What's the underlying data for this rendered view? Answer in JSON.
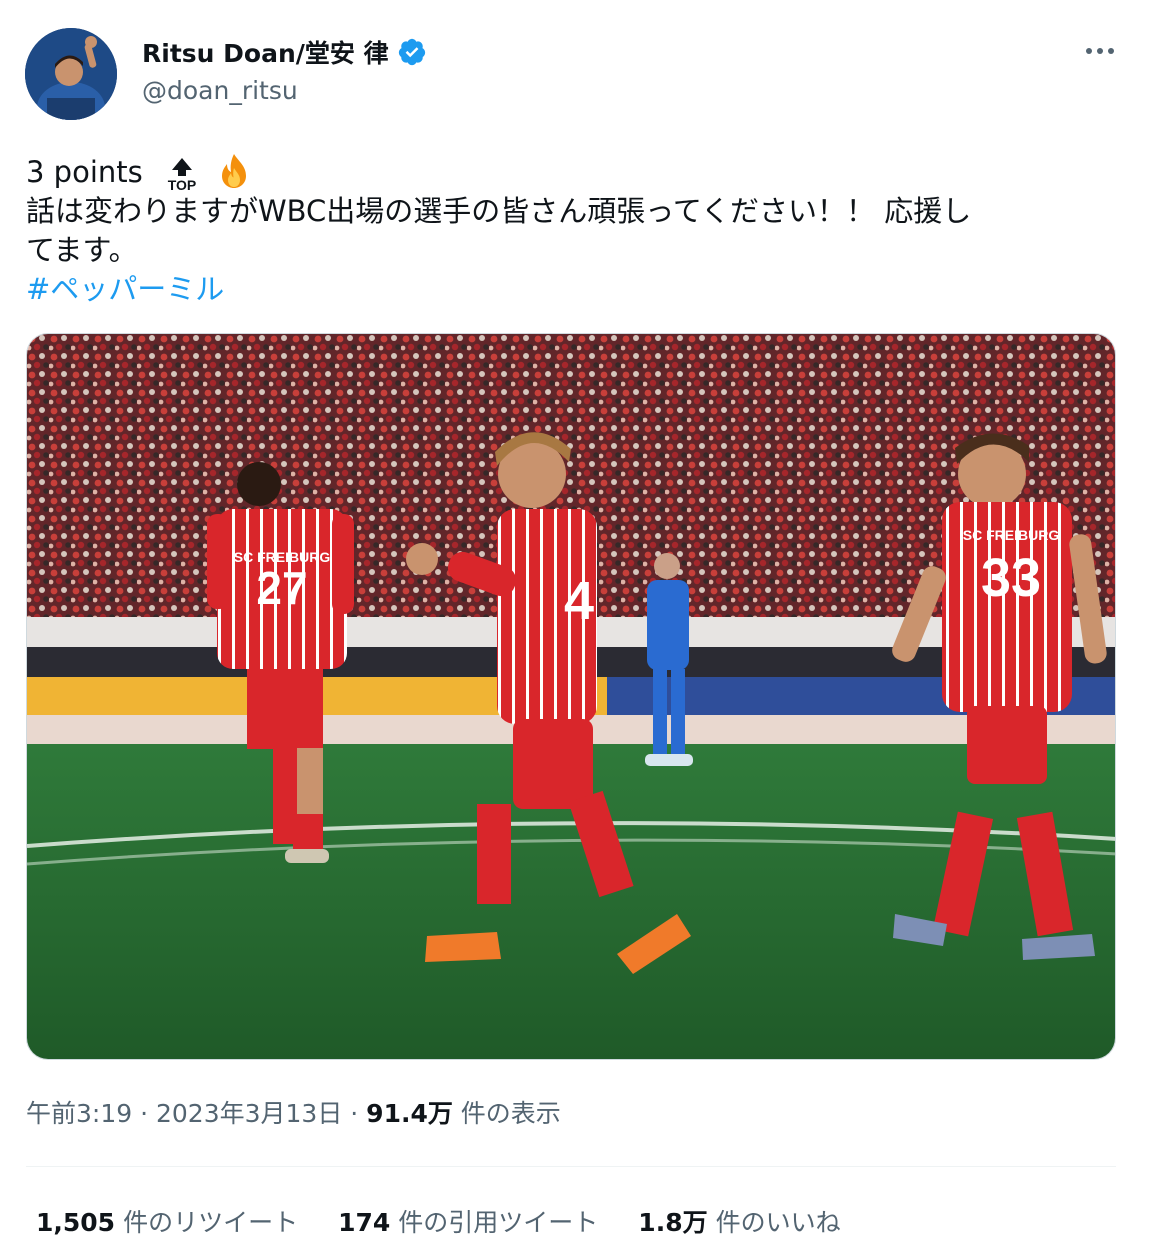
{
  "author": {
    "display_name": "Ritsu Doan/堂安 律",
    "handle": "@doan_ritsu",
    "verified": true
  },
  "tweet": {
    "line1_text": "3 points",
    "line2_text": "話は変わりますがWBC出場の選手の皆さん頑張ってください！！ 応援し",
    "line3_text": "てます。",
    "hashtag": "#ペッパーミル",
    "emojis": [
      "top-arrow-emoji",
      "fire-emoji"
    ]
  },
  "photo": {
    "jersey_numbers": [
      "27",
      "33"
    ],
    "jersey_text": "SC FREIBURG"
  },
  "meta": {
    "time": "午前3:19",
    "separator1": " · ",
    "date": "2023年3月13日",
    "separator2": " · ",
    "views_count": "91.4万",
    "views_label": " 件の表示"
  },
  "stats": {
    "retweets_count": "1,505",
    "retweets_label": "件のリツイート",
    "quotes_count": "174",
    "quotes_label": "件の引用ツイート",
    "likes_count": "1.8万",
    "likes_label": "件のいいね"
  },
  "colors": {
    "accent": "#1d9bf0",
    "text_primary": "#0f1419",
    "text_secondary": "#536471",
    "kit_red": "#d9262b"
  }
}
